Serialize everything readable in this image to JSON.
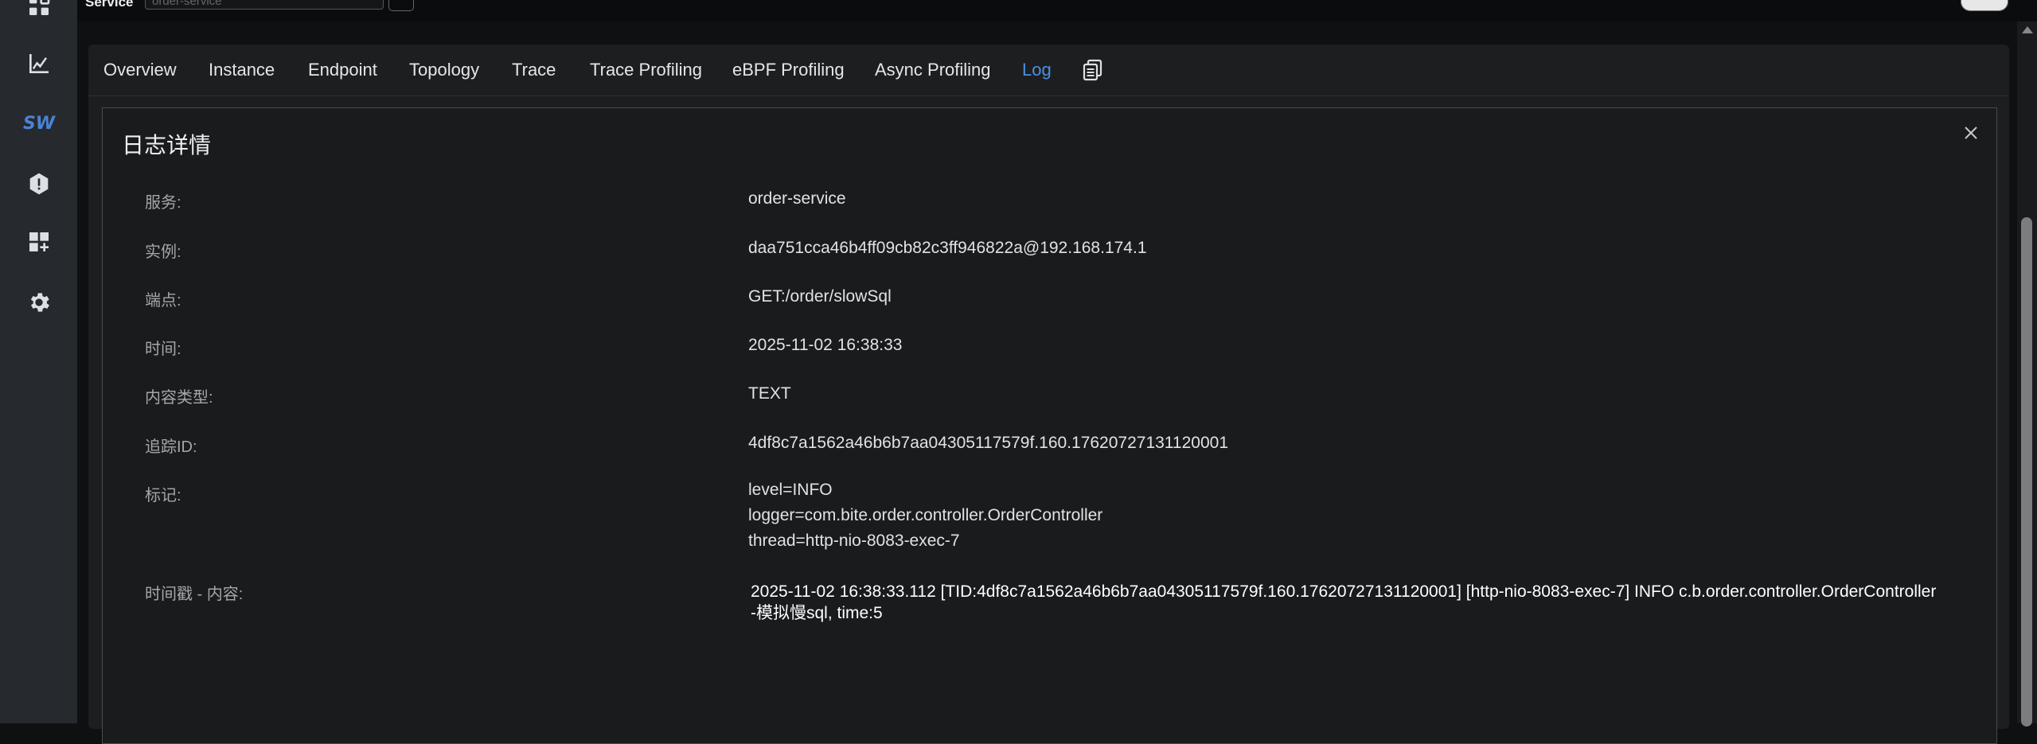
{
  "header": {
    "service_label": "Service",
    "service_input_value": "order-service"
  },
  "rail": {
    "icons": [
      "dashboard-icon",
      "chart-icon",
      "sw-logo",
      "alarm-icon",
      "add-widget-icon",
      "settings-icon"
    ],
    "logo_text": "SW"
  },
  "tabs": [
    {
      "label": "Overview"
    },
    {
      "label": "Instance"
    },
    {
      "label": "Endpoint"
    },
    {
      "label": "Topology"
    },
    {
      "label": "Trace"
    },
    {
      "label": "Trace Profiling"
    },
    {
      "label": "eBPF Profiling"
    },
    {
      "label": "Async Profiling"
    },
    {
      "label": "Log",
      "active": true
    }
  ],
  "dialog": {
    "title": "日志详情",
    "fields": [
      {
        "label": "服务:",
        "value": "order-service"
      },
      {
        "label": "实例:",
        "value": "daa751cca46b4ff09cb82c3ff946822a@192.168.174.1"
      },
      {
        "label": "端点:",
        "value": "GET:/order/slowSql"
      },
      {
        "label": "时间:",
        "value": "2025-11-02 16:38:33"
      },
      {
        "label": "内容类型:",
        "value": "TEXT"
      },
      {
        "label": "追踪ID:",
        "value": "4df8c7a1562a46b6b7aa04305117579f.160.17620727131120001"
      }
    ],
    "tags_label": "标记:",
    "tags": [
      "level=INFO",
      "logger=com.bite.order.controller.OrderController",
      "thread=http-nio-8083-exec-7"
    ],
    "content_label": "时间戳 - 内容:",
    "content": "2025-11-02 16:38:33.112 [TID:4df8c7a1562a46b6b7aa04305117579f.160.17620727131120001] [http-nio-8083-exec-7] INFO  c.b.order.controller.OrderController -模拟慢sql, time:5"
  },
  "colors": {
    "accent": "#4a90e2",
    "background": "#0f1012",
    "panel": "#1d1e20",
    "rail": "#26292e"
  }
}
